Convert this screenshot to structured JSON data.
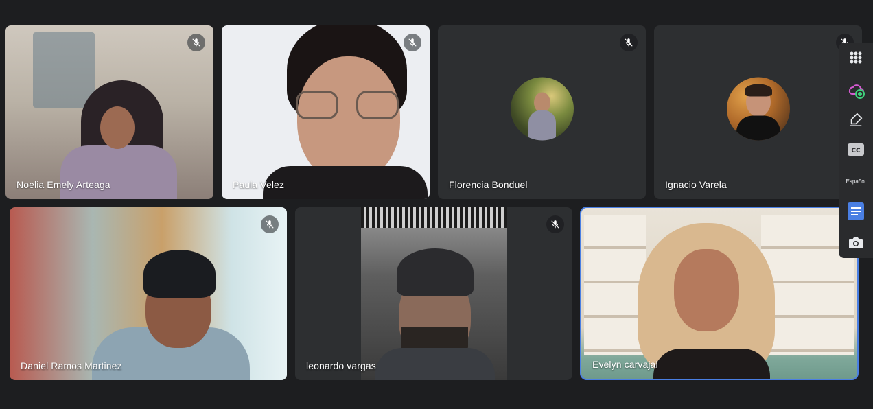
{
  "participants": [
    {
      "name": "Noelia Emely Arteaga",
      "muted": true,
      "video": true
    },
    {
      "name": "Paula Velez",
      "muted": true,
      "video": true
    },
    {
      "name": "Florencia Bonduel",
      "muted": true,
      "video": false
    },
    {
      "name": "Ignacio Varela",
      "muted": true,
      "video": false
    },
    {
      "name": "Daniel Ramos Martinez",
      "muted": true,
      "video": true
    },
    {
      "name": "leonardo vargas",
      "muted": true,
      "video": true
    },
    {
      "name": "Evelyn carvajal",
      "muted": false,
      "video": true,
      "active_speaker": true
    }
  ],
  "side_panel": {
    "language_label": "Español",
    "icons": [
      "apps-icon",
      "weather-extension-icon",
      "highlighter-icon",
      "closed-captions-icon",
      "language-label",
      "document-icon",
      "camera-icon"
    ]
  },
  "colors": {
    "background": "#1d1e20",
    "tile": "#3c4043",
    "active_outline": "#4a7fe3"
  }
}
